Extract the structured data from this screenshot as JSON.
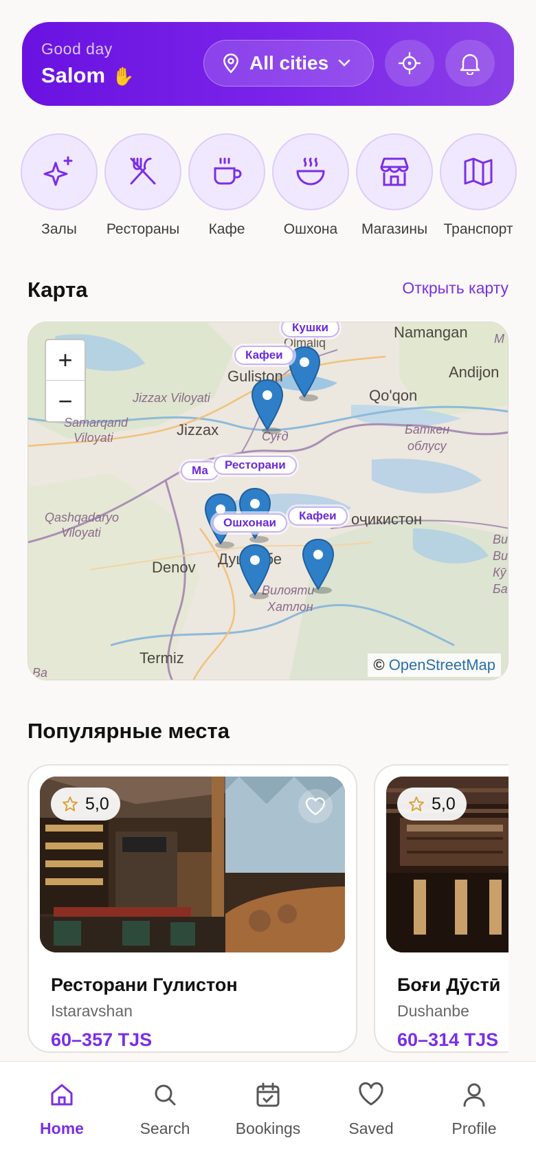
{
  "header": {
    "greeting_small": "Good day",
    "greeting_big": "Salom",
    "city_selector": "All cities"
  },
  "categories": [
    {
      "label": "Залы",
      "icon": "sparkle-icon"
    },
    {
      "label": "Рестораны",
      "icon": "fork-knife-icon"
    },
    {
      "label": "Кафе",
      "icon": "coffee-cup-icon"
    },
    {
      "label": "Ошхона",
      "icon": "steaming-bowl-icon"
    },
    {
      "label": "Магазины",
      "icon": "store-icon"
    },
    {
      "label": "Транспорт",
      "icon": "map-icon"
    }
  ],
  "map_section": {
    "title": "Карта",
    "open_link": "Открыть карту",
    "attribution_symbol": "©",
    "attribution": "OpenStreetMap",
    "places": {
      "namangan": "Namangan",
      "andijon": "Andijon",
      "qoqon": "Qo'qon",
      "olmaliq": "Olmaliq",
      "guliston": "Guliston",
      "jizzax_viloyati": "Jizzax Viloyati",
      "jizzax": "Jizzax",
      "samarqand": "Samarqand",
      "viloyati": "Viloyati",
      "sugd": "Суғд",
      "batken": "Баткен",
      "oblusu": "облусу",
      "qashqadaryo": "Qashqadaryo",
      "qashqadaryo_viloyati": "Viloyati",
      "tojikiston": "оҷикистон",
      "denov": "Denov",
      "dushanbe": "Душанбе",
      "viloyati_khatlon": "Вилояти",
      "khatlon": "Хатлон",
      "termiz": "Termiz",
      "edge_m": "M",
      "edge_vi": "Ви",
      "edge_ku": "Кӯ",
      "edge_ba": "Ба",
      "edge_vi2": "Ви",
      "ba2": "Ba"
    },
    "labels": [
      "Кушки",
      "Кафеи",
      "Ма",
      "Ресторани",
      "Кафеи",
      "Ошхонаи"
    ]
  },
  "popular": {
    "title": "Популярные места",
    "cards": [
      {
        "rating": "5,0",
        "name": "Ресторани Гулистон",
        "city": "Istaravshan",
        "price": "60–357 TJS"
      },
      {
        "rating": "5,0",
        "name": "Боғи Дӯстӣ",
        "city": "Dushanbe",
        "price": "60–314 TJS"
      }
    ]
  },
  "nav": [
    {
      "label": "Home",
      "icon": "home-icon",
      "active": true
    },
    {
      "label": "Search",
      "icon": "search-icon"
    },
    {
      "label": "Bookings",
      "icon": "calendar-icon"
    },
    {
      "label": "Saved",
      "icon": "heart-icon"
    },
    {
      "label": "Profile",
      "icon": "user-icon"
    }
  ],
  "colors": {
    "accent": "#7a2ee6",
    "header_gradient_start": "#6a12e0",
    "header_gradient_end": "#8a3fe6",
    "marker_blue": "#2f7fc8"
  }
}
